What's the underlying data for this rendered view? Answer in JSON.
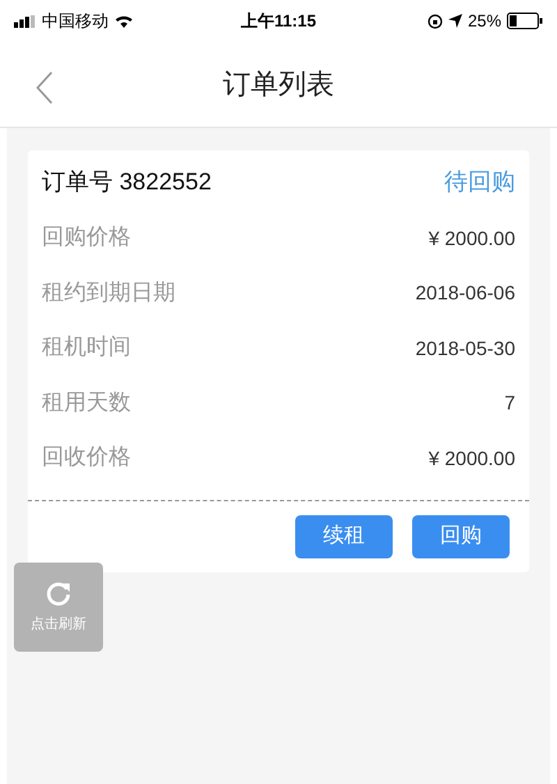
{
  "status_bar": {
    "carrier": "中国移动",
    "time": "上午11:15",
    "battery": "25%"
  },
  "nav": {
    "title": "订单列表"
  },
  "order": {
    "number": "订单号 3822552",
    "status": "待回购",
    "fields": [
      {
        "label": "回购价格",
        "value": "¥ 2000.00"
      },
      {
        "label": "租约到期日期",
        "value": "2018-06-06"
      },
      {
        "label": "租机时间",
        "value": "2018-05-30"
      },
      {
        "label": "租用天数",
        "value": "7"
      },
      {
        "label": "回收价格",
        "value": "¥ 2000.00"
      }
    ],
    "buttons": [
      "续租",
      "回购"
    ]
  },
  "refresh_button": {
    "label": "点击刷新"
  }
}
